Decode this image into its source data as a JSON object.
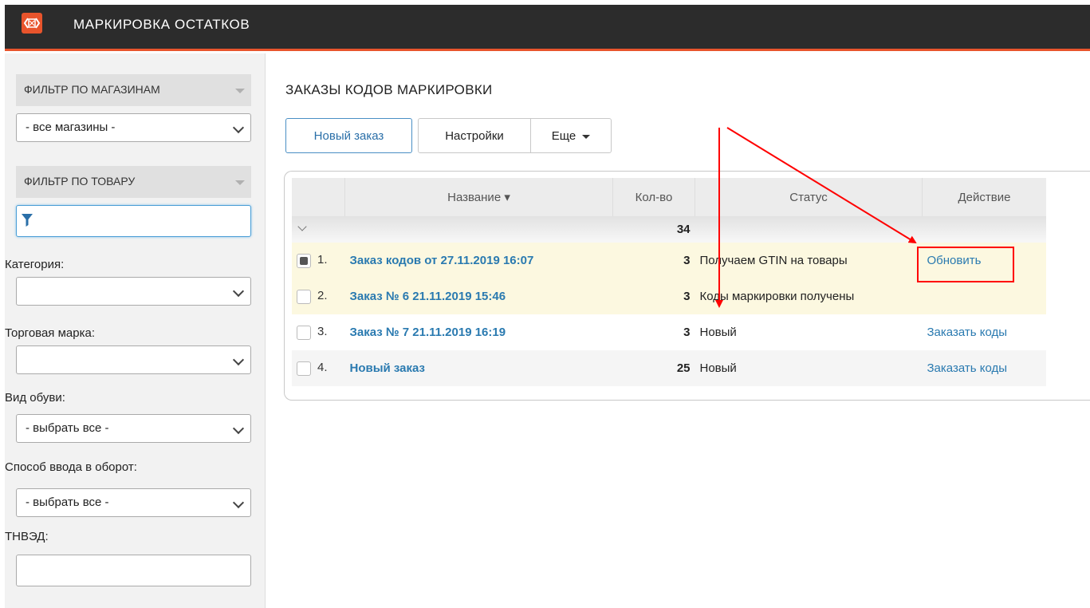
{
  "header": {
    "title": "МАРКИРОВКА ОСТАТКОВ",
    "logo_icon": "marking-logo-icon",
    "accent": "#e8542c"
  },
  "sidebar": {
    "store_filter": {
      "title": "ФИЛЬТР ПО МАГАЗИНАМ",
      "value": "- все магазины -"
    },
    "product_filter": {
      "title": "ФИЛЬТР ПО ТОВАРУ",
      "search_value": ""
    },
    "fields": [
      {
        "label": "Категория:",
        "value": ""
      },
      {
        "label": "Торговая марка:",
        "value": ""
      },
      {
        "label": "Вид обуви:",
        "value": "- выбрать все -"
      },
      {
        "label": "Способ ввода в оборот:",
        "value": "- выбрать все -"
      },
      {
        "label": "ТНВЭД:",
        "value": ""
      }
    ]
  },
  "main": {
    "title": "ЗАКАЗЫ КОДОВ МАРКИРОВКИ",
    "toolbar": {
      "new_order": "Новый заказ",
      "settings": "Настройки",
      "more": "Еще"
    },
    "table": {
      "columns": [
        "",
        "Название ▾",
        "Кол-во",
        "Статус",
        "Действие"
      ],
      "group_total": "34",
      "rows": [
        {
          "num": "1.",
          "name": "Заказ кодов от 27.11.2019 16:07",
          "qty": "3",
          "status": "Получаем GTIN на товары",
          "action": "Обновить",
          "checked": true
        },
        {
          "num": "2.",
          "name": "Заказ № 6 21.11.2019 15:46",
          "qty": "3",
          "status": "Коды маркировки получены",
          "action": "",
          "checked": false
        },
        {
          "num": "3.",
          "name": "Заказ № 7 21.11.2019 16:19",
          "qty": "3",
          "status": "Новый",
          "action": "Заказать коды",
          "checked": false
        },
        {
          "num": "4.",
          "name": "Новый заказ",
          "qty": "25",
          "status": "Новый",
          "action": "Заказать коды",
          "checked": false
        }
      ]
    }
  },
  "annotation_color": "#ff0000"
}
